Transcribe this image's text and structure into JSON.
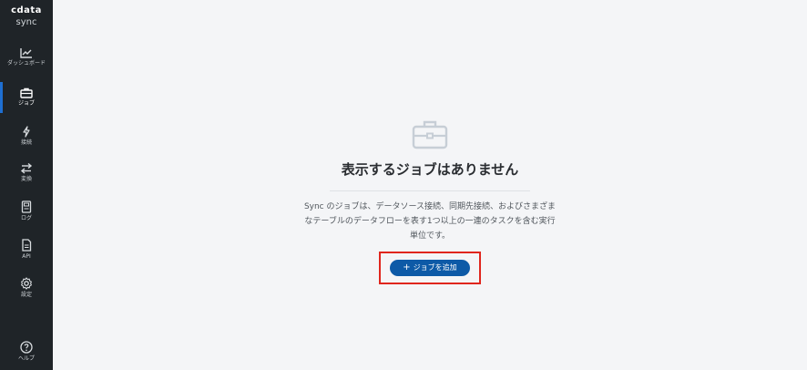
{
  "app": {
    "brand": "cdata",
    "product": "sync"
  },
  "sidebar": {
    "items": [
      {
        "label": "ダッシュボード",
        "icon": "chart-icon"
      },
      {
        "label": "ジョブ",
        "icon": "briefcase-icon",
        "active": true
      },
      {
        "label": "接続",
        "icon": "plug-icon"
      },
      {
        "label": "変換",
        "icon": "swap-icon"
      },
      {
        "label": "ログ",
        "icon": "log-icon"
      },
      {
        "label": "API",
        "icon": "api-file-icon"
      },
      {
        "label": "設定",
        "icon": "gear-icon"
      }
    ],
    "help_label": "ヘルプ"
  },
  "main": {
    "empty_title": "表示するジョブはありません",
    "empty_desc_line1": "Sync のジョブは、データソース接続、同期先接続、およびさまざま",
    "empty_desc_line2": "なテーブルのデータフローを表す1つ以上の一連のタスクを含む実行",
    "empty_desc_line3": "単位です。",
    "add_job_label": "ジョブを追加"
  },
  "colors": {
    "sidebar_bg": "#1f2428",
    "active_indicator": "#1e6fd2",
    "primary_button": "#0d5aa7",
    "highlight_border": "#e0261d"
  }
}
